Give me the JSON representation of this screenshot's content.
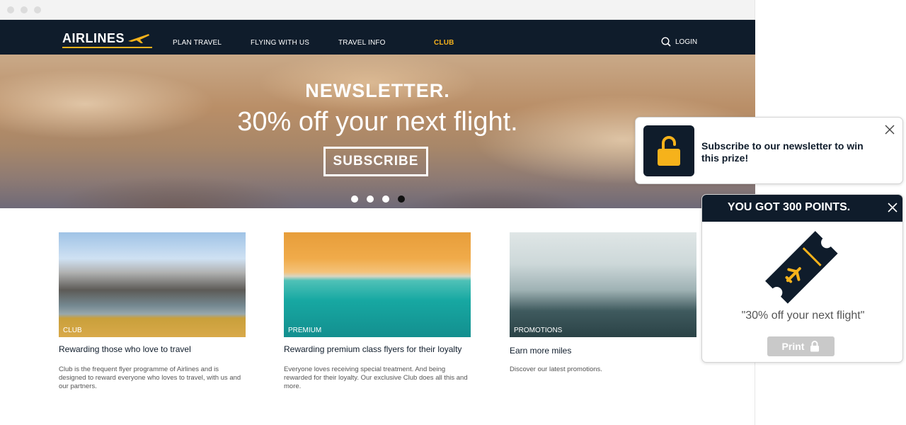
{
  "nav": {
    "logo": "AIRLINES",
    "items": [
      "PLAN TRAVEL",
      "FLYING WITH US",
      "TRAVEL INFO",
      "CLUB"
    ],
    "login": "LOGIN",
    "active_color": "#f6b21b"
  },
  "hero": {
    "title": "NEWSLETTER.",
    "subtitle": "30% off your next flight.",
    "button": "SUBSCRIBE",
    "slides": 4,
    "active_slide": 4
  },
  "cards": [
    {
      "tag": "CLUB",
      "title": "Rewarding those who love to travel",
      "text": "Club is the frequent flyer programme of Airlines and is designed to reward everyone who loves to travel, with us and our partners."
    },
    {
      "tag": "PREMIUM",
      "title": "Rewarding premium class flyers for their loyalty",
      "text": "Everyone loves receiving special treatment. And being rewarded for their loyalty. Our exclusive Club does all this and more."
    },
    {
      "tag": "PROMOTIONS",
      "title": "Earn more miles",
      "text": "Discover our latest promotions."
    }
  ],
  "popup_newsletter": {
    "text": "Subscribe to our newsletter to win this prize!",
    "icon": "unlock-icon"
  },
  "popup_points": {
    "title": "YOU GOT 300 POINTS.",
    "quote": "\"30% off your next flight\"",
    "print": "Print",
    "icon": "ticket-icon"
  },
  "colors": {
    "navy": "#0f1c2b",
    "accent": "#f6b21b"
  }
}
